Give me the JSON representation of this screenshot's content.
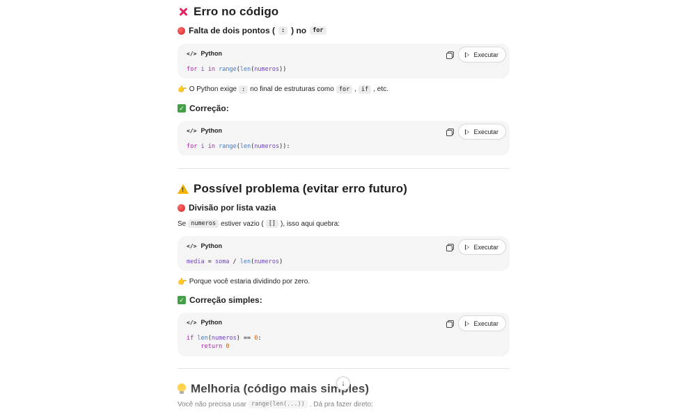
{
  "section1": {
    "title": "Erro no código",
    "subtitle": "Falta de dois pontos ( : ) no",
    "subtitle_code_colon": ":",
    "subtitle_pre": "Falta de dois pontos (",
    "subtitle_mid": ") no",
    "subtitle_code_for": "for",
    "code1": {
      "lang": "Python",
      "run_label": "Executar",
      "line1": "for i in range(len(numeros))"
    },
    "note_pre": "O Python exige",
    "note_code_colon": ":",
    "note_mid": "no final de estruturas como",
    "note_code_for": "for",
    "note_comma": ",",
    "note_code_if": "if",
    "note_end": ", etc.",
    "correction_title": "Correção:",
    "code2": {
      "lang": "Python",
      "run_label": "Executar",
      "line1": "for i in range(len(numeros)):"
    }
  },
  "section2": {
    "title": "Possível problema (evitar erro futuro)",
    "subtitle": "Divisão por lista vazia",
    "text_pre": "Se",
    "text_code_numeros": "numeros",
    "text_mid": "estiver vazio (",
    "text_code_list": "[]",
    "text_end": "), isso aqui quebra:",
    "code3": {
      "lang": "Python",
      "run_label": "Executar",
      "line1": "media = soma / len(numeros)"
    },
    "note": "Porque você estaria dividindo por zero.",
    "correction_title": "Correção simples:",
    "code4": {
      "lang": "Python",
      "run_label": "Executar",
      "line1": "if len(numeros) == 0:",
      "line2": "    return 0"
    }
  },
  "section3": {
    "title": "Melhoria (código mais simples)",
    "text_pre": "Você não precisa usar",
    "text_code": "range(len(...))",
    "text_end": ". Dá pra fazer direto:"
  },
  "colors": {
    "keyword": "#a626a4",
    "function": "#4078c8",
    "variable": "#6f42c1",
    "number": "#d05c00",
    "code_bg": "#f5f5f5"
  }
}
